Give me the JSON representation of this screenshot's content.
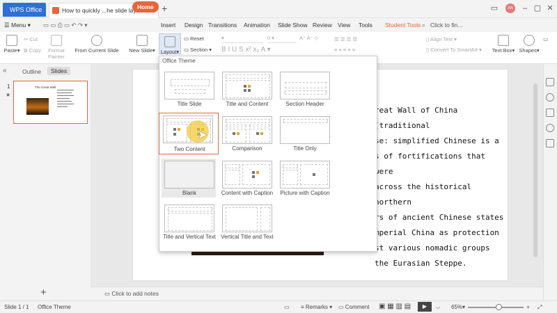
{
  "titlebar": {
    "app_tab": "WPS Office",
    "doc_tab": "How to quickly ...he slide layout",
    "new_tab": "+",
    "avatar_initials": "AA"
  },
  "menu": {
    "items": [
      "Menu",
      "Home",
      "Insert",
      "Design",
      "Transitions",
      "Animation",
      "Slide Show",
      "Review",
      "View",
      "Tools",
      "Student Tools"
    ],
    "search": "Click to fin..."
  },
  "ribbon": {
    "paste": "Paste",
    "cut": "Cut",
    "copy": "Copy",
    "format_painter": "Format Painter",
    "from_current_slide": "From Current Slide",
    "new_slide": "New Slide",
    "layout": "Layout",
    "reset": "Reset",
    "section": "Section",
    "font_size": "0",
    "align_text": "Align Text",
    "convert_smartart": "Convert To SmartArt",
    "text_box": "Text Box",
    "shapes": "Shapes"
  },
  "left_panel": {
    "outline_tab": "Outline",
    "slides_tab": "Slides",
    "slide_number": "1",
    "thumb_title": "The Great Wall",
    "add_slide": "+"
  },
  "dropdown": {
    "heading": "Office Theme",
    "layouts": [
      "Title Slide",
      "Title and Content",
      "Section Header",
      "Two Content",
      "Comparison",
      "Title Only",
      "Blank",
      "Content with Caption",
      "Picture with Caption",
      "Title and Vertical Text",
      "Vertical Title and Text"
    ],
    "selected": "Two Content"
  },
  "slide": {
    "lines": [
      "reat Wall of China (traditional",
      "se:  simplified Chinese is a",
      "s of fortifications that were",
      "across the historical northern",
      "rs of ancient Chinese states",
      "mperial China as protection",
      "st various nomadic groups",
      "the Eurasian Steppe."
    ]
  },
  "notes": {
    "placeholder": "Click to add notes"
  },
  "status": {
    "slide_count": "Slide 1 / 1",
    "theme": "Office Theme",
    "remarks": "Remarks",
    "comment": "Comment",
    "zoom": "65%"
  },
  "colors": {
    "accent": "#e8643a",
    "brand_blue": "#2f6fd7"
  }
}
